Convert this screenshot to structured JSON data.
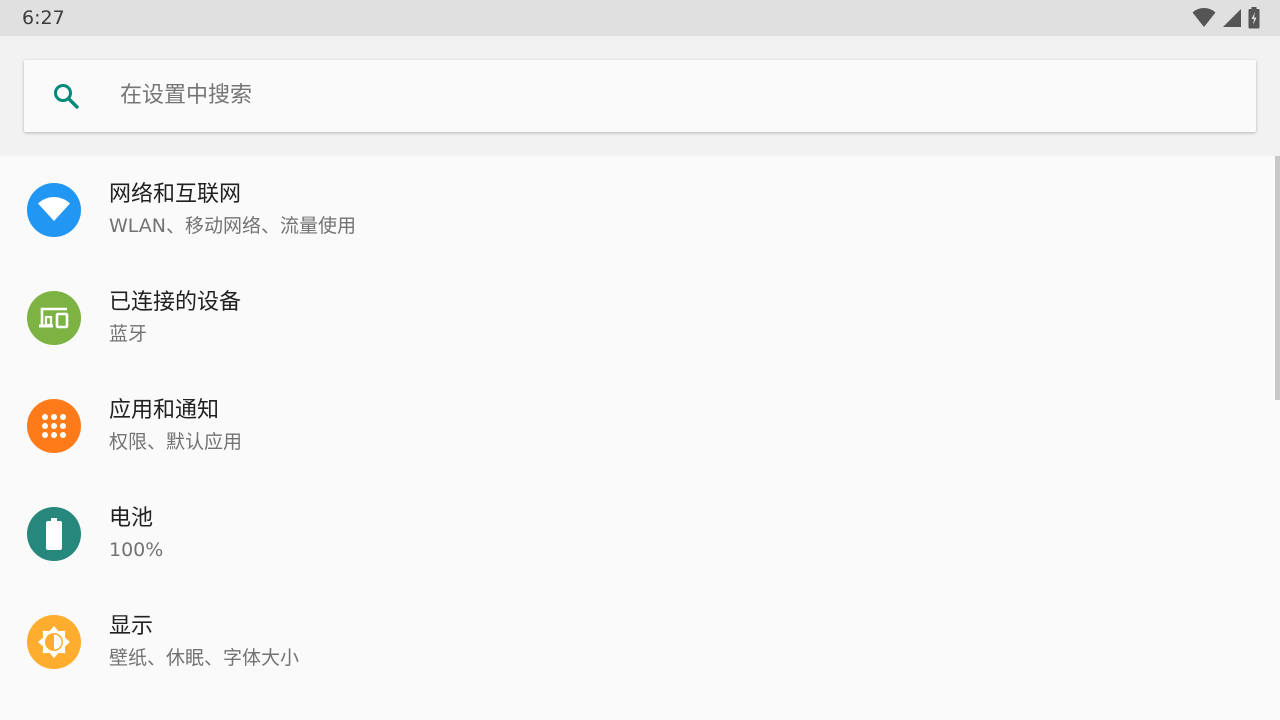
{
  "status_bar": {
    "time": "6:27",
    "icons": [
      "wifi-icon",
      "cell-signal-icon",
      "battery-charging-icon"
    ]
  },
  "search": {
    "placeholder": "在设置中搜索",
    "icon": "search-icon"
  },
  "colors": {
    "accent": "#00897b",
    "network": "#2196f3",
    "connected_devices": "#7cb342",
    "apps": "#ff7b1a",
    "battery": "#26877d",
    "display": "#ffad2f"
  },
  "settings": [
    {
      "title": "网络和互联网",
      "summary": "WLAN、移动网络、流量使用",
      "icon": "wifi-icon"
    },
    {
      "title": "已连接的设备",
      "summary": "蓝牙",
      "icon": "devices-icon"
    },
    {
      "title": "应用和通知",
      "summary": "权限、默认应用",
      "icon": "apps-grid-icon"
    },
    {
      "title": "电池",
      "summary": "100%",
      "icon": "battery-icon"
    },
    {
      "title": "显示",
      "summary": "壁纸、休眠、字体大小",
      "icon": "brightness-icon"
    }
  ]
}
